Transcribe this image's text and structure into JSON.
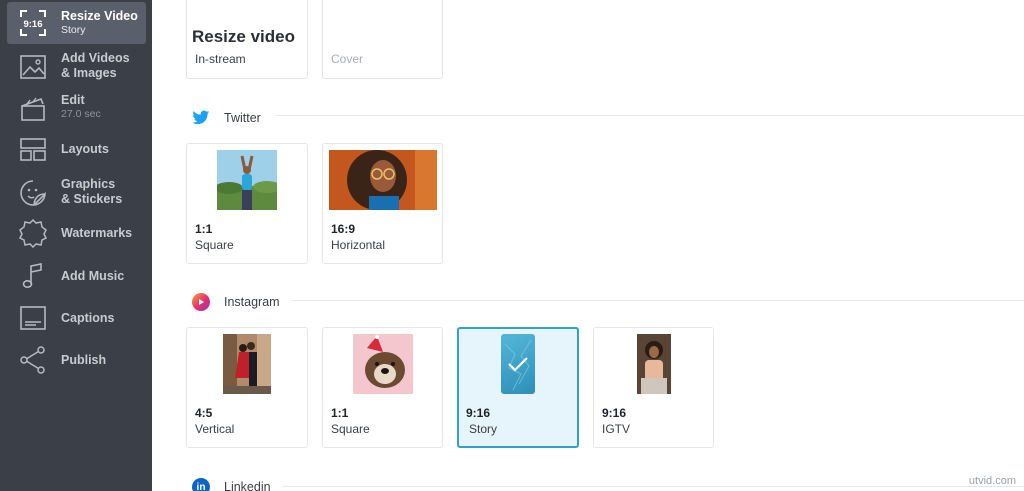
{
  "sidebar": {
    "items": [
      {
        "badge": "9:16",
        "label": "Resize Video",
        "sub": "Story"
      },
      {
        "label": "Add Videos",
        "label2": "& Images"
      },
      {
        "label": "Edit",
        "sub": "27.0 sec"
      },
      {
        "label": "Layouts"
      },
      {
        "label": "Graphics",
        "label2": "& Stickers"
      },
      {
        "label": "Watermarks"
      },
      {
        "label": "Add Music"
      },
      {
        "label": "Captions"
      },
      {
        "label": "Publish"
      }
    ]
  },
  "main": {
    "title": "Resize video",
    "top_cards": [
      {
        "label": "In-stream"
      },
      {
        "label": "Cover"
      }
    ],
    "sections": [
      {
        "name": "Twitter",
        "icon": "twitter-icon",
        "color": "#1da1f2"
      },
      {
        "name": "Instagram",
        "icon": "instagram-icon",
        "color": "#e1306c"
      },
      {
        "name": "Linkedin",
        "icon": "linkedin-icon",
        "color": "#0a66c2"
      }
    ],
    "twitter_cards": [
      {
        "ratio": "1:1",
        "label": "Square"
      },
      {
        "ratio": "16:9",
        "label": "Horizontal"
      }
    ],
    "instagram_cards": [
      {
        "ratio": "4:5",
        "label": "Vertical"
      },
      {
        "ratio": "1:1",
        "label": "Square"
      },
      {
        "ratio": "9:16",
        "label": "Story",
        "selected": true
      },
      {
        "ratio": "9:16",
        "label": "IGTV"
      }
    ]
  },
  "watermark": "utvid.com",
  "colors": {
    "sidebar_bg": "#3a3f48",
    "sidebar_active": "#5a606b",
    "selected_border": "#2fa0cf",
    "selected_bg": "#e6f4fb"
  }
}
